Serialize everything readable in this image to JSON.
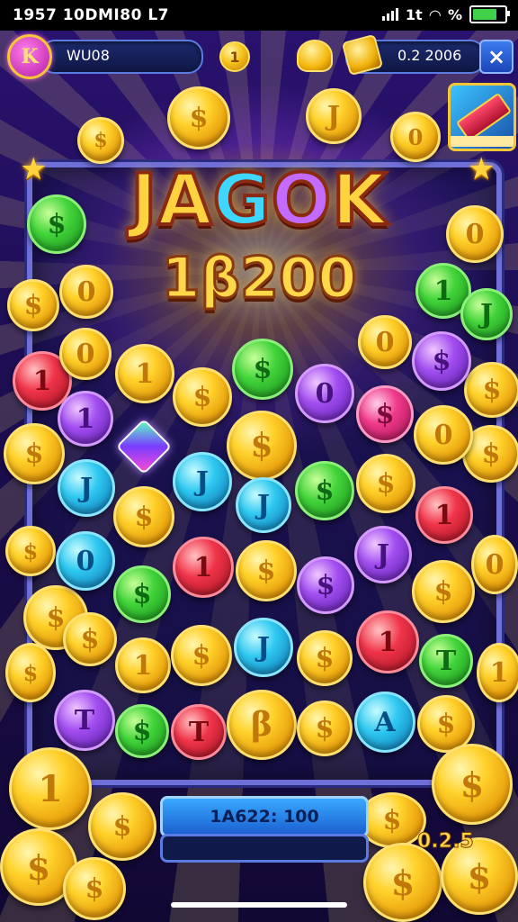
{
  "status_bar": {
    "time": "1957 10DMI80 L7",
    "network": "1t",
    "percent": "%"
  },
  "header": {
    "level_badge": "K",
    "level_value": "WU08",
    "coin_symbol": "1",
    "balance": "0.2 2006",
    "close_label": "×"
  },
  "title": {
    "part1": "JA",
    "part2": "G",
    "part3": "O",
    "part4": "K"
  },
  "jackpot_amount": "1β200",
  "footer": {
    "bet_display": "1A622: 100",
    "side_value": "0.2.5"
  },
  "coins": {
    "dollar": "$",
    "one": "1",
    "j": "J",
    "t": "T",
    "a": "A",
    "zero": "0",
    "b": "β"
  }
}
